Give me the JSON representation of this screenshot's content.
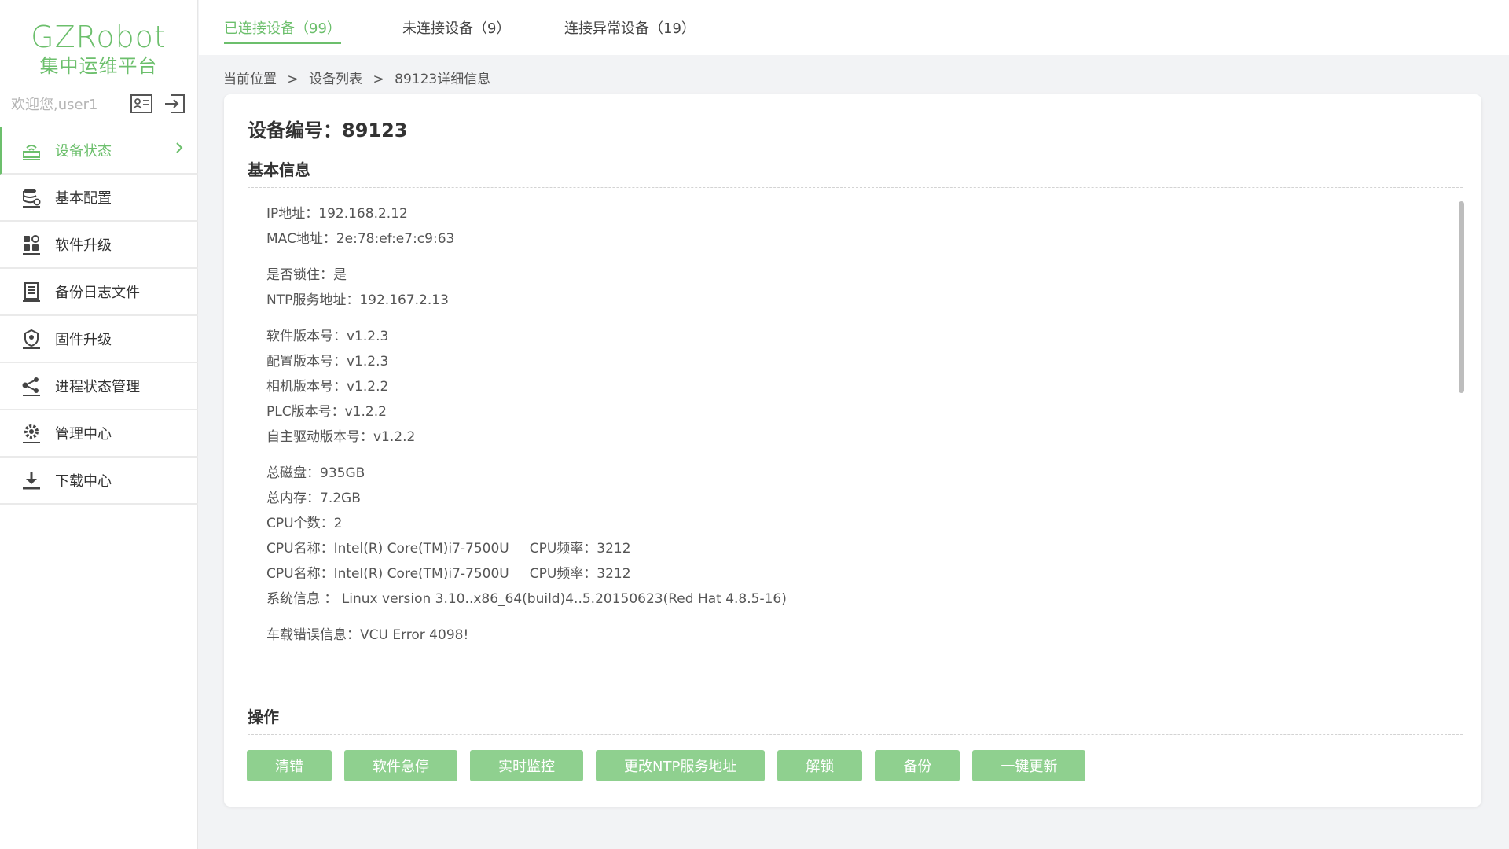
{
  "app": {
    "logo_title": "GZRobot",
    "logo_subtitle": "集中运维平台",
    "welcome": "欢迎您,user1",
    "accent": "#6cbf6c"
  },
  "sidebar": {
    "items": [
      {
        "label": "设备状态",
        "icon": "router-icon",
        "active": true
      },
      {
        "label": "基本配置",
        "icon": "database-gear-icon"
      },
      {
        "label": "软件升级",
        "icon": "apps-grid-icon"
      },
      {
        "label": "备份日志文件",
        "icon": "document-icon"
      },
      {
        "label": "固件升级",
        "icon": "chip-icon"
      },
      {
        "label": "进程状态管理",
        "icon": "share-icon"
      },
      {
        "label": "管理中心",
        "icon": "gear-icon"
      },
      {
        "label": "下载中心",
        "icon": "download-icon"
      }
    ]
  },
  "tabs": [
    {
      "label": "已连接设备（99）",
      "active": true
    },
    {
      "label": "未连接设备（9）"
    },
    {
      "label": "连接异常设备（19）"
    }
  ],
  "breadcrumb": [
    "当前位置",
    ">",
    "设备列表",
    ">",
    "89123详细信息"
  ],
  "device": {
    "title": "设备编号：89123",
    "basic_title": "基本信息",
    "ops_title": "操作",
    "ip": "IP地址：192.168.2.12",
    "mac": "MAC地址：2e:78:ef:e7:c9:63",
    "locked": "是否锁住：是",
    "ntp": "NTP服务地址：192.167.2.13",
    "software": "软件版本号：v1.2.3",
    "config": "配置版本号：v1.2.3",
    "camera": "相机版本号：v1.2.2",
    "plc": "PLC版本号：v1.2.2",
    "drive": "自主驱动版本号：v1.2.2",
    "disk": "总磁盘：935GB",
    "memory": "总内存：7.2GB",
    "cpu_count": "CPU个数：2",
    "cpu1_name": "CPU名称：Intel(R) Core(TM)i7-7500U",
    "cpu1_freq": "CPU频率：3212",
    "cpu2_name": "CPU名称：Intel(R) Core(TM)i7-7500U",
    "cpu2_freq": "CPU频率：3212",
    "system": "系统信息 ： Linux version 3.10..x86_64(build)4..5.20150623(Red Hat 4.8.5-16)",
    "error": "车载错误信息：VCU Error 4098!"
  },
  "actions": [
    "清错",
    "软件急停",
    "实时监控",
    "更改NTP服务地址",
    "解锁",
    "备份",
    "一键更新"
  ]
}
